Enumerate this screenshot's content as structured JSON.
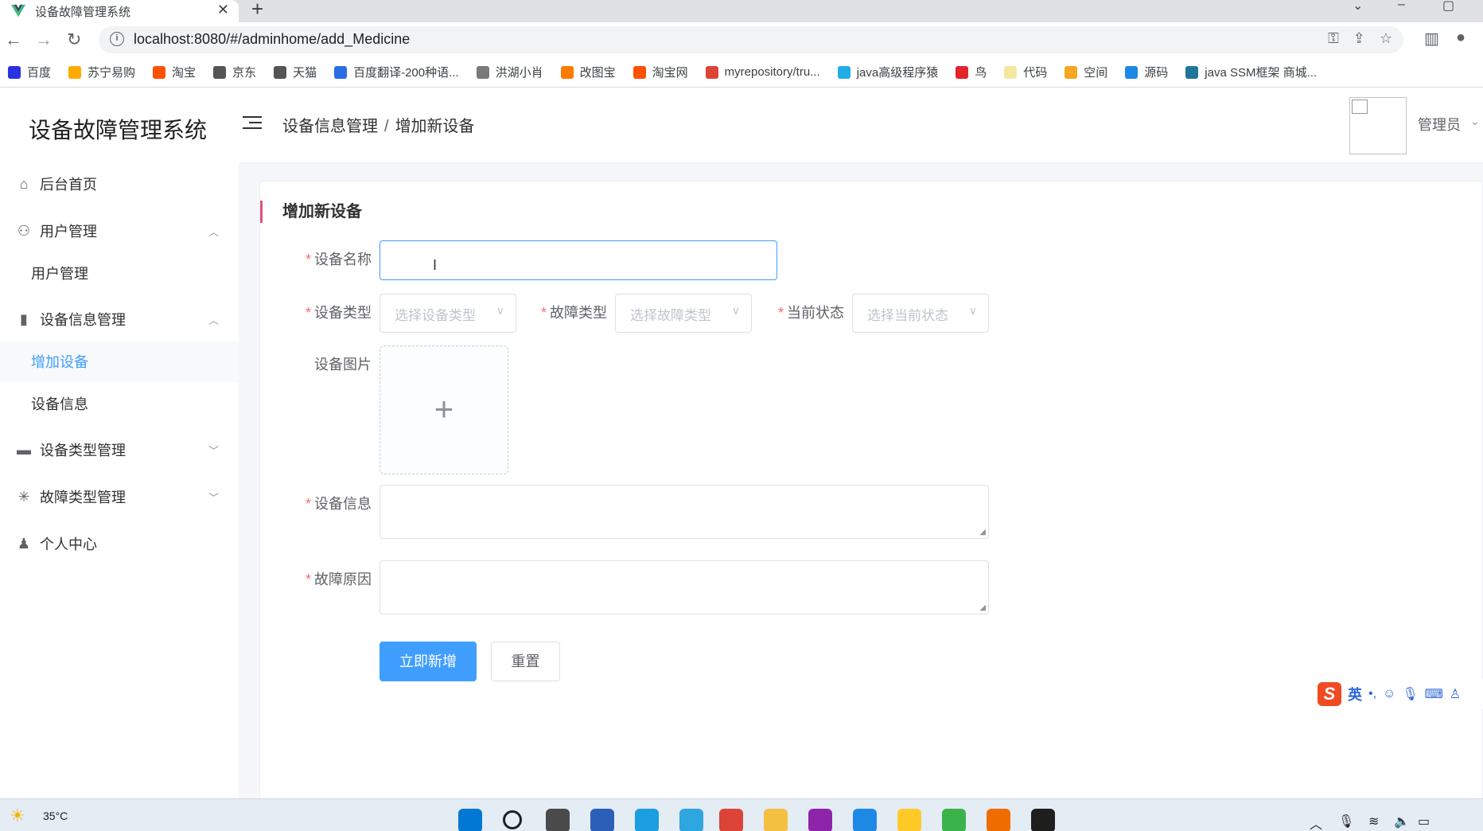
{
  "browser": {
    "tab_title": "设备故障管理系统",
    "url": "localhost:8080/#/adminhome/add_Medicine",
    "bookmarks": [
      {
        "label": "百度",
        "color": "#2932e1"
      },
      {
        "label": "苏宁易购",
        "color": "#ffaa00"
      },
      {
        "label": "淘宝",
        "color": "#ff5000"
      },
      {
        "label": "京东",
        "color": "#555555"
      },
      {
        "label": "天猫",
        "color": "#555555"
      },
      {
        "label": "百度翻译-200种语...",
        "color": "#2b6de5"
      },
      {
        "label": "洪湖小肖",
        "color": "#7a7a7a"
      },
      {
        "label": "改图宝",
        "color": "#ff7a00"
      },
      {
        "label": "淘宝网",
        "color": "#ff5000"
      },
      {
        "label": "myrepository/tru...",
        "color": "#db4437"
      },
      {
        "label": "java高级程序猿",
        "color": "#23ade5"
      },
      {
        "label": "鸟",
        "color": "#e3242b"
      },
      {
        "label": "代码",
        "color": "#f4e7a1"
      },
      {
        "label": "空间",
        "color": "#f5a623"
      },
      {
        "label": "源码",
        "color": "#1e88e5"
      },
      {
        "label": "java SSM框架 商城...",
        "color": "#21759b"
      }
    ]
  },
  "app": {
    "logo": "设备故障管理系统",
    "breadcrumb": {
      "parent": "设备信息管理",
      "separator": "/",
      "current": "增加新设备"
    },
    "user": {
      "name": "管理员"
    }
  },
  "sidebar": {
    "home": "后台首页",
    "user_mgmt": "用户管理",
    "user_mgmt_sub": "用户管理",
    "device_mgmt": "设备信息管理",
    "device_add": "增加设备",
    "device_info": "设备信息",
    "type_mgmt": "设备类型管理",
    "fault_type_mgmt": "故障类型管理",
    "profile": "个人中心"
  },
  "form": {
    "title": "增加新设备",
    "required_mark": "*",
    "name_label": "设备名称",
    "name_value": "",
    "type_label": "设备类型",
    "type_placeholder": "选择设备类型",
    "fault_label": "故障类型",
    "fault_placeholder": "选择故障类型",
    "status_label": "当前状态",
    "status_placeholder": "选择当前状态",
    "image_label": "设备图片",
    "info_label": "设备信息",
    "reason_label": "故障原因",
    "submit": "立即新增",
    "reset": "重置"
  },
  "ime": {
    "mode": "英"
  },
  "taskbar": {
    "temperature": "35°C"
  },
  "colors": {
    "primary": "#409eff",
    "required": "#f56c6c",
    "title_accent": "#e4537a"
  }
}
